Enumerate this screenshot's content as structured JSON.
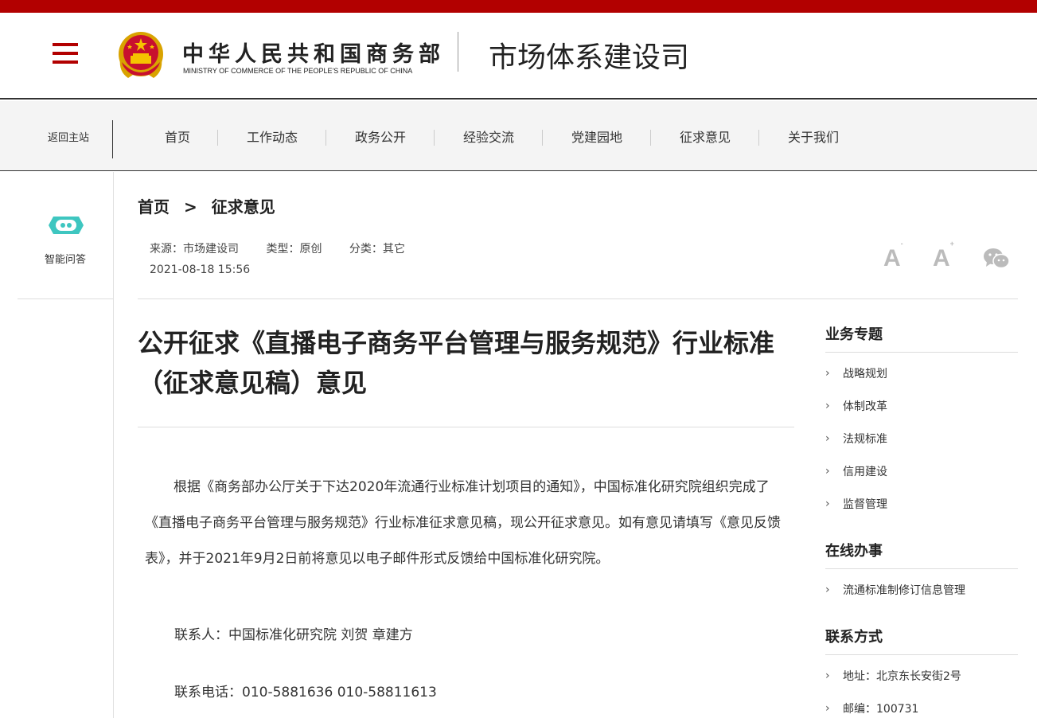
{
  "header": {
    "ministry_cn": "中华人民共和国商务部",
    "ministry_en": "MINISTRY OF COMMERCE OF THE PEOPLE'S REPUBLIC OF CHINA",
    "site_title": "市场体系建设司"
  },
  "nav": {
    "back_main": "返回主站",
    "items": [
      "首页",
      "工作动态",
      "政务公开",
      "经验交流",
      "党建园地",
      "征求意见",
      "关于我们"
    ]
  },
  "assistant": {
    "label": "智能问答"
  },
  "breadcrumb": {
    "home": "首页",
    "separator": ">",
    "current": "征求意见"
  },
  "meta": {
    "source": "来源：市场建设司",
    "type": "类型：原创",
    "category": "分类：其它",
    "date": "2021-08-18 15:56"
  },
  "tools": {
    "font_smaller": "A",
    "font_larger": "A",
    "minus": "-",
    "plus": "+"
  },
  "article": {
    "title": "公开征求《直播电子商务平台管理与服务规范》行业标准（征求意见稿）意见",
    "paragraph": "根据《商务部办公厅关于下达2020年流通行业标准计划项目的通知》，中国标准化研究院组织完成了《直播电子商务平台管理与服务规范》行业标准征求意见稿，现公开征求意见。如有意见请填写《意见反馈表》，并于2021年9月2日前将意见以电子邮件形式反馈给中国标准化研究院。",
    "contact_person": "联系人：中国标准化研究院 刘贺 章建方",
    "contact_phone": "联系电话：010-5881636 010-58811613"
  },
  "sidebar": {
    "topics_head": "业务专题",
    "topics": [
      "战略规划",
      "体制改革",
      "法规标准",
      "信用建设",
      "监督管理"
    ],
    "online_head": "在线办事",
    "online": [
      "流通标准制修订信息管理"
    ],
    "contact_head": "联系方式",
    "contact": [
      "地址：北京东长安街2号",
      "邮编：100731"
    ]
  },
  "colors": {
    "brand_red": "#b20000",
    "bot_teal": "#3ec6c0"
  }
}
